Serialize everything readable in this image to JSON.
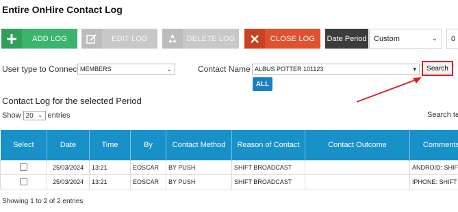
{
  "page": {
    "title": "Entire OnHire Contact Log"
  },
  "toolbar": {
    "add_label": "ADD LOG",
    "edit_label": "EDIT LOG",
    "delete_label": "DELETE LOG",
    "close_label": "CLOSE LOG",
    "date_period_label": "Date Period",
    "date_period_value": "Custom",
    "extra_value": "0"
  },
  "filters": {
    "user_type_label": "User type to Connect",
    "user_type_value": "MEMBERS",
    "contact_name_label": "Contact Name",
    "contact_name_value": "ALBUS POTTER 101123",
    "required_mark": "*",
    "search_label": "Search",
    "all_label": "ALL"
  },
  "section": {
    "title": "Contact Log for the selected Period",
    "show_label": "Show",
    "entries_value": "20",
    "entries_label": "entries",
    "search_text": "Search te"
  },
  "table": {
    "headers": [
      "Select",
      "Date",
      "Time",
      "By",
      "Contact Method",
      "Reason of Contact",
      "Contact Outcome",
      "Comments"
    ],
    "rows": [
      {
        "date": "25/03/2024",
        "time": "13:21",
        "by": "EOSCAR",
        "method": "BY PUSH",
        "reason": "SHIFT BROADCAST",
        "outcome": "",
        "comments": "ANDROID: SHIFT AVAIL..."
      },
      {
        "date": "25/03/2024",
        "time": "13:21",
        "by": "EOSCAR",
        "method": "BY PUSH",
        "reason": "SHIFT BROADCAST",
        "outcome": "",
        "comments": "IPHONE: SHIFT AVAILAB..."
      }
    ]
  },
  "footer": {
    "text": "Showing 1 to 2 of 2 entries"
  },
  "colors": {
    "add": "#3bb56b",
    "disabled": "#c8c8c8",
    "close": "#e0522f",
    "header": "#1891c9",
    "annotation": "#e02020"
  }
}
